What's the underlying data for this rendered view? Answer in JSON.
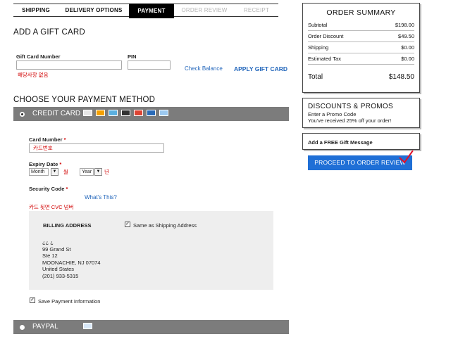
{
  "tabs": [
    "SHIPPING",
    "DELIVERY OPTIONS",
    "PAYMENT",
    "ORDER REVIEW",
    "RECEIPT"
  ],
  "gift": {
    "title": "ADD A GIFT CARD",
    "number_label": "Gift Card Number",
    "pin_label": "PIN",
    "no_result": "해당사항 없음",
    "check_balance": "Check Balance",
    "apply": "APPLY GIFT CARD"
  },
  "payment": {
    "title": "CHOOSE YOUR PAYMENT METHOD",
    "credit_card": "CREDIT CARD",
    "card_number_label": "Card Number",
    "required_mark": "*",
    "card_number_value": "카드번호",
    "expiry_label": "Expiry Date",
    "month": "Month",
    "month_kr": "월",
    "year": "Year",
    "year_kr": "년",
    "security_label": "Security Code",
    "whats_this": "What's This?",
    "cvc_note": "카드 뒷면 CVC 넘버",
    "paypal": "PAYPAL",
    "save_payment": "Save Payment Information"
  },
  "billing": {
    "title": "BILLING ADDRESS",
    "same_as": "Same as Shipping Address",
    "lines": [
      "¿¿ ¿",
      "99 Grand St",
      "Ste 12",
      "MOONACHIE, NJ 07074",
      "United States",
      "(201) 933-5315"
    ]
  },
  "summary": {
    "title": "ORDER SUMMARY",
    "rows": [
      {
        "label": "Subtotal",
        "value": "$198.00"
      },
      {
        "label": "Order Discount",
        "value": "$49.50"
      },
      {
        "label": "Shipping",
        "value": "$0.00"
      },
      {
        "label": "Estimated Tax",
        "value": "$0.00"
      }
    ],
    "total_label": "Total",
    "total_value": "$148.50"
  },
  "promos": {
    "title": "DISCOUNTS & PROMOS",
    "line1": "Enter a Promo Code",
    "line2": "You've received 25% off your order!"
  },
  "gift_message": "Add a FREE Gift Message",
  "proceed": "PROCEED TO ORDER REVIEW",
  "colors": {
    "bar": "#7c7c7c",
    "accent_blue": "#1f6fd6",
    "link": "#2266bb",
    "note_red": "#d10000"
  }
}
